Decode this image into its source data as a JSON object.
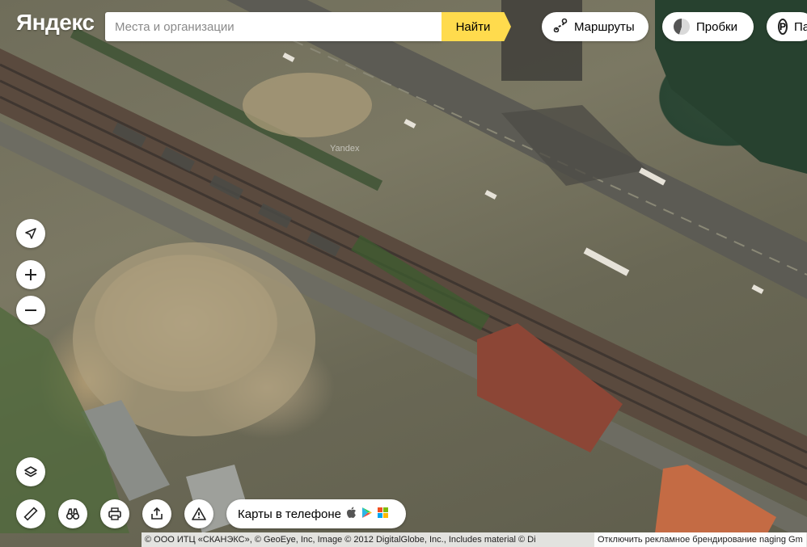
{
  "header": {
    "logo": "Яндекс",
    "search_placeholder": "Места и организации",
    "search_value": "",
    "find_button": "Найти"
  },
  "toolbar": {
    "routes_label": "Маршруты",
    "traffic_label": "Пробки",
    "parking_label": "Парковки"
  },
  "map": {
    "watermark": "Yandex",
    "imagery_year": "2012"
  },
  "controls": {
    "locate_icon": "location-arrow-icon",
    "zoom_in": "+",
    "zoom_out": "−",
    "layers_icon": "layers-icon",
    "ruler_icon": "ruler-icon",
    "panorama_icon": "binoculars-icon",
    "print_icon": "printer-icon",
    "share_icon": "share-icon",
    "report_icon": "warning-icon"
  },
  "promo": {
    "mobile_label": "Карты в телефоне"
  },
  "footer": {
    "copyright": "© ООО ИТЦ «СКАНЭКС», © GeoEye, Inc, Image © 2012 DigitalGlobe, Inc., Includes material © Di",
    "ad_disable": "Отключить рекламное брендирование",
    "tail": "naging Gm"
  },
  "colors": {
    "find_button": "#ffdb4d",
    "control_bg": "#ffffff"
  }
}
